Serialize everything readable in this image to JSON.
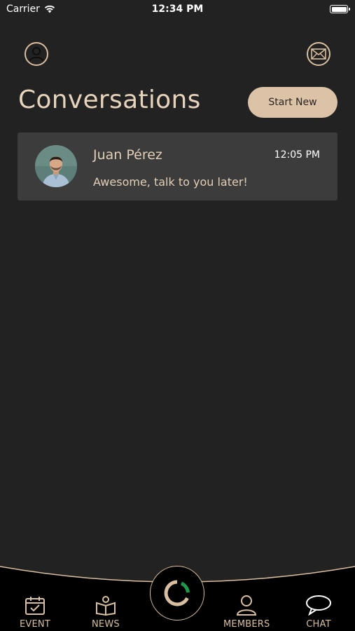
{
  "status_bar": {
    "carrier": "Carrier",
    "time": "12:34 PM"
  },
  "header": {
    "title": "Conversations",
    "start_new_label": "Start New"
  },
  "conversations": [
    {
      "name": "Juan Pérez",
      "time": "12:05 PM",
      "last_message": "Awesome, talk to you later!"
    }
  ],
  "bottom_nav": {
    "items": [
      {
        "label": "EVENT",
        "icon": "calendar-check-icon"
      },
      {
        "label": "NEWS",
        "icon": "book-icon"
      },
      {
        "label": "MEMBERS",
        "icon": "person-icon"
      },
      {
        "label": "CHAT",
        "icon": "chat-bubble-icon"
      }
    ],
    "center_icon": "app-logo-icon"
  },
  "colors": {
    "background": "#222222",
    "accent": "#dcc3a7",
    "card": "#3c3c3c",
    "logo_green": "#1d9a4a"
  }
}
